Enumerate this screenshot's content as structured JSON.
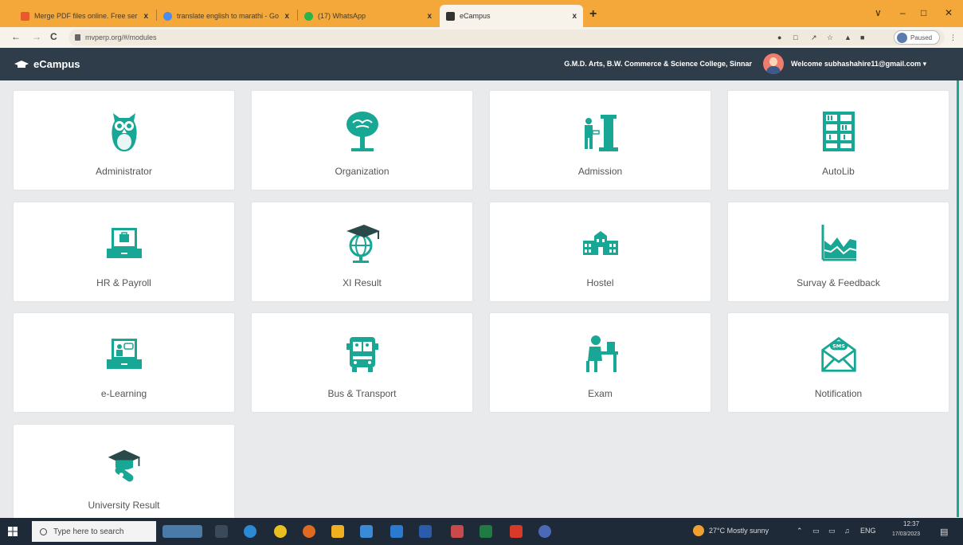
{
  "browser": {
    "tabs": [
      {
        "title": "Merge PDF files online. Free ser",
        "close": "x",
        "favicon": "pdf-icon",
        "color": "#e85a2a"
      },
      {
        "title": "translate english to marathi - Go",
        "close": "x",
        "favicon": "google-icon",
        "color": "#4a8df0"
      },
      {
        "title": "(17) WhatsApp",
        "close": "x",
        "favicon": "whatsapp-icon",
        "color": "#2bb34a"
      },
      {
        "title": "eCampus",
        "close": "x",
        "favicon": "ecampus-icon",
        "color": "#333333"
      }
    ],
    "new_tab": "+",
    "window_controls": {
      "minimize": "–",
      "restore": "□",
      "close": "✕",
      "tabs_menu": "∨"
    },
    "url": "mvperp.org/#/modules",
    "profile_status": "Paused"
  },
  "app": {
    "brand": "eCampus",
    "college": "G.M.D. Arts, B.W. Commerce & Science College, Sinnar",
    "welcome": "Welcome subhashahire11@gmail.com ▾",
    "accent_color": "#18a794",
    "navbar_color": "#2f3d4a"
  },
  "modules": [
    {
      "label": "Administrator",
      "icon": "owl-icon"
    },
    {
      "label": "Organization",
      "icon": "tree-icon"
    },
    {
      "label": "Admission",
      "icon": "admission-desk-icon"
    },
    {
      "label": "AutoLib",
      "icon": "library-shelf-icon"
    },
    {
      "label": "HR & Payroll",
      "icon": "laptop-briefcase-icon"
    },
    {
      "label": "XI Result",
      "icon": "globe-graduation-cap-icon"
    },
    {
      "label": "Hostel",
      "icon": "building-icon"
    },
    {
      "label": "Survay & Feedback",
      "icon": "area-chart-icon"
    },
    {
      "label": "e-Learning",
      "icon": "laptop-teacher-icon"
    },
    {
      "label": "Bus & Transport",
      "icon": "bus-icon"
    },
    {
      "label": "Exam",
      "icon": "student-desk-icon"
    },
    {
      "label": "Notification",
      "icon": "sms-envelope-icon"
    },
    {
      "label": "University Result",
      "icon": "graduation-cap-diploma-icon"
    }
  ],
  "taskbar": {
    "search_placeholder": "Type here to search",
    "weather": "27°C  Mostly sunny",
    "language": "ENG",
    "time": "12:37",
    "date": "17/03/2023"
  }
}
